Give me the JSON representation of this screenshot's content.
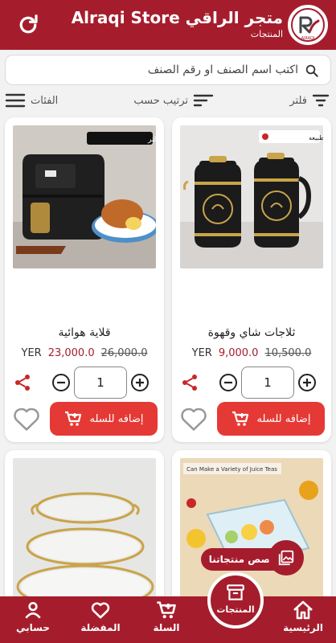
{
  "header": {
    "store_name": "Alraqi Store متجر الراقي",
    "subtitle": "المنتجات",
    "logo_text": "AlRAQI"
  },
  "search": {
    "placeholder": "اكتب اسم الصنف او رقم الصنف"
  },
  "toolbar": {
    "filter": "فلتر",
    "sort": "ترتيب حسب",
    "categories": "الفئات"
  },
  "products": [
    {
      "title": "ثلاجات شاي وقهوة",
      "badge": "صوره على الطبيعه",
      "old_price": "10,500.0",
      "new_price": "9,000.0",
      "currency": "YER",
      "qty": "1",
      "add_label": "إضافه للسله"
    },
    {
      "title": "قلاية هوائية",
      "badge": "قلاية كهربائية 6 لتر",
      "old_price": "26,000.0",
      "new_price": "23,000.0",
      "currency": "YER",
      "qty": "1",
      "add_label": "إضافه للسله"
    },
    {
      "badge": "Can Make a Variety of Juice Teas"
    },
    {}
  ],
  "reels_label": "قصص منتجاتنا",
  "nav": {
    "home": "الرئيسية",
    "products": "المنتجات",
    "cart": "السلة",
    "favorites": "المفضلة",
    "account": "حسابي"
  },
  "colors": {
    "primary": "#a51d2d",
    "button": "#e53935"
  }
}
